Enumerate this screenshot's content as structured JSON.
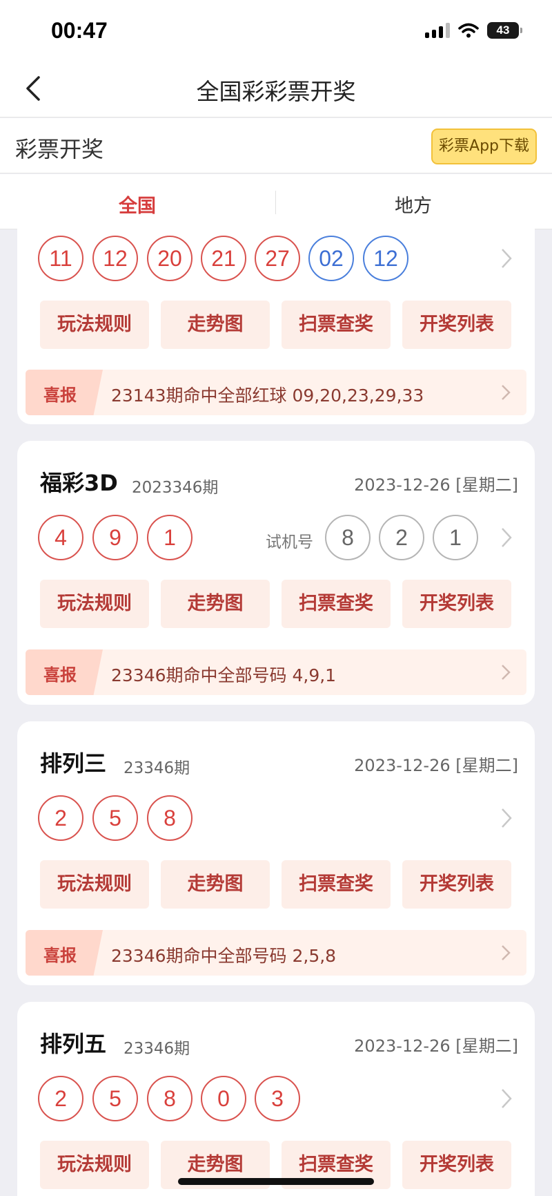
{
  "status_bar": {
    "time": "00:47",
    "battery": "43"
  },
  "nav": {
    "title": "全国彩彩票开奖"
  },
  "header": {
    "title": "彩票开奖",
    "download_label": "彩票App下载"
  },
  "tabs": [
    {
      "label": "全国"
    },
    {
      "label": "地方"
    }
  ],
  "colors": {
    "accent": "#e24040",
    "red_ball": "#d9403c",
    "blue_ball": "#3d6fd4",
    "button_bg": "#fdeee8",
    "download_bg": "#ffe17c"
  },
  "cards": [
    {
      "red_balls": [
        "11",
        "12",
        "20",
        "21",
        "27"
      ],
      "blue_balls": [
        "02",
        "12"
      ],
      "actions": [
        "玩法规则",
        "走势图",
        "扫票查奖",
        "开奖列表"
      ],
      "news": {
        "badge": "喜报",
        "text": "23143期命中全部红球 09,20,23,29,33"
      }
    },
    {
      "name": "福彩3D",
      "period": "2023346期",
      "date": "2023-12-26 [星期二]",
      "red_balls": [
        "4",
        "9",
        "1"
      ],
      "trial_label": "试机号",
      "trial_balls": [
        "8",
        "2",
        "1"
      ],
      "actions": [
        "玩法规则",
        "走势图",
        "扫票查奖",
        "开奖列表"
      ],
      "news": {
        "badge": "喜报",
        "text": "23346期命中全部号码 4,9,1"
      }
    },
    {
      "name": "排列三",
      "period": "23346期",
      "date": "2023-12-26 [星期二]",
      "red_balls": [
        "2",
        "5",
        "8"
      ],
      "actions": [
        "玩法规则",
        "走势图",
        "扫票查奖",
        "开奖列表"
      ],
      "news": {
        "badge": "喜报",
        "text": "23346期命中全部号码 2,5,8"
      }
    },
    {
      "name": "排列五",
      "period": "23346期",
      "date": "2023-12-26 [星期二]",
      "red_balls": [
        "2",
        "5",
        "8",
        "0",
        "3"
      ],
      "actions": [
        "玩法规则",
        "走势图",
        "扫票查奖",
        "开奖列表"
      ]
    }
  ]
}
